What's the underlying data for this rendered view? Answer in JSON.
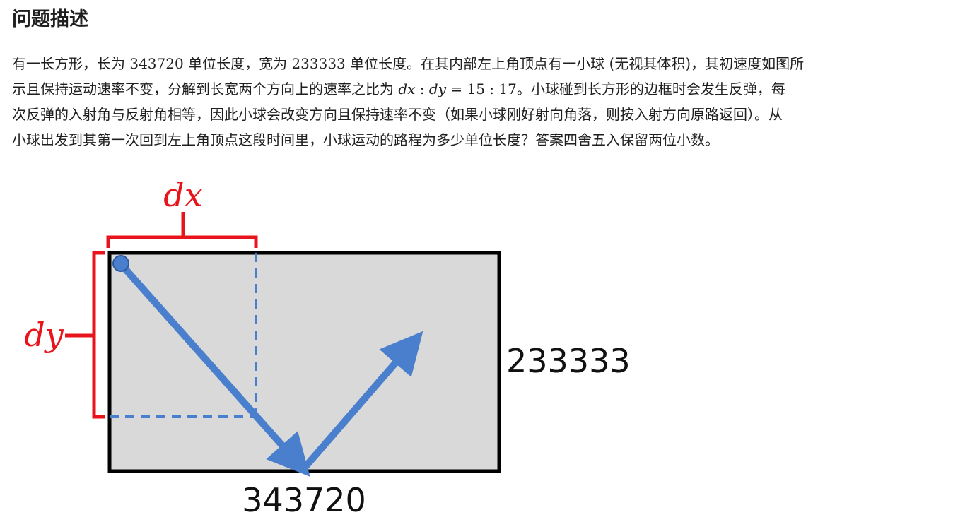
{
  "title": "问题描述",
  "paragraph": {
    "line1_a": "有一长方形，长为 ",
    "length": "343720",
    "line1_b": " 单位长度，宽为 ",
    "width": "233333",
    "line1_c": " 单位长度。在其内部左上角顶点有一小球 (无视其体积)，其初速度如图所",
    "line2_a": "示且保持运动速率不变，分解到长宽两个方向上的速率之比为 ",
    "ratio_math": {
      "dx": "dx",
      "colon1": " : ",
      "dy": "dy",
      "eq": " = ",
      "a": "15",
      "colon2": " : ",
      "b": "17"
    },
    "line2_b": "。小球碰到长方形的边框时会发生反弹，每",
    "line3": "次反弹的入射角与反射角相等，因此小球会改变方向且保持速率不变（如果小球刚好射向角落，则按入射方向原路返回）。从",
    "line4": "小球出发到其第一次回到左上角顶点这段时间里，小球运动的路程为多少单位长度？答案四舍五入保留两位小数。"
  },
  "figure": {
    "dx_label": "dx",
    "dy_label": "dy",
    "width_label": "233333",
    "length_label": "343720",
    "colors": {
      "rect_fill": "#d9d9d9",
      "rect_stroke": "#000000",
      "annotation": "#e8141b",
      "arrow": "#4a7fce"
    }
  }
}
